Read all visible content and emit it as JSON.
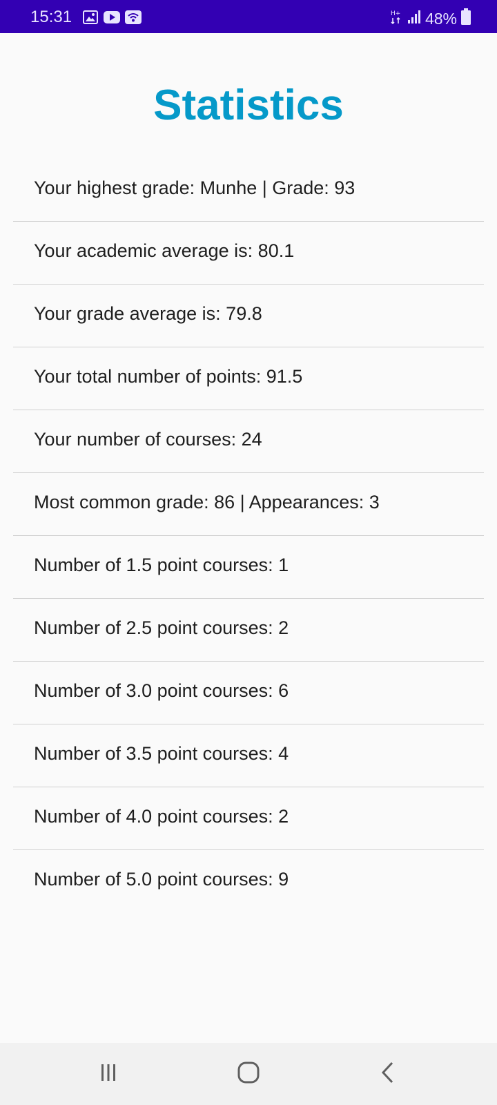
{
  "status_bar": {
    "time": "15:31",
    "battery": "48%",
    "icons": [
      "gallery-icon",
      "youtube-icon",
      "wifi-icon",
      "data-arrows-icon",
      "signal-icon",
      "battery-icon"
    ]
  },
  "page": {
    "title": "Statistics"
  },
  "stats": [
    {
      "text": "Your highest grade: Munhe |  Grade: 93"
    },
    {
      "text": "Your academic average is: 80.1"
    },
    {
      "text": "Your grade average is: 79.8"
    },
    {
      "text": "Your total number of points: 91.5"
    },
    {
      "text": "Your number of courses: 24"
    },
    {
      "text": "Most common grade: 86 |  Appearances: 3"
    },
    {
      "text": "Number of 1.5 point courses: 1"
    },
    {
      "text": "Number of 2.5 point courses: 2"
    },
    {
      "text": "Number of 3.0 point courses: 6"
    },
    {
      "text": "Number of 3.5 point courses: 4"
    },
    {
      "text": "Number of 4.0 point courses: 2"
    },
    {
      "text": "Number of 5.0 point courses: 9"
    }
  ],
  "nav_bar": {
    "buttons": [
      "recents-icon",
      "home-icon",
      "back-icon"
    ]
  },
  "colors": {
    "status_bar": "#3300b3",
    "title": "#0599c9",
    "background": "#fafafa",
    "divider": "#d0d0d0"
  }
}
